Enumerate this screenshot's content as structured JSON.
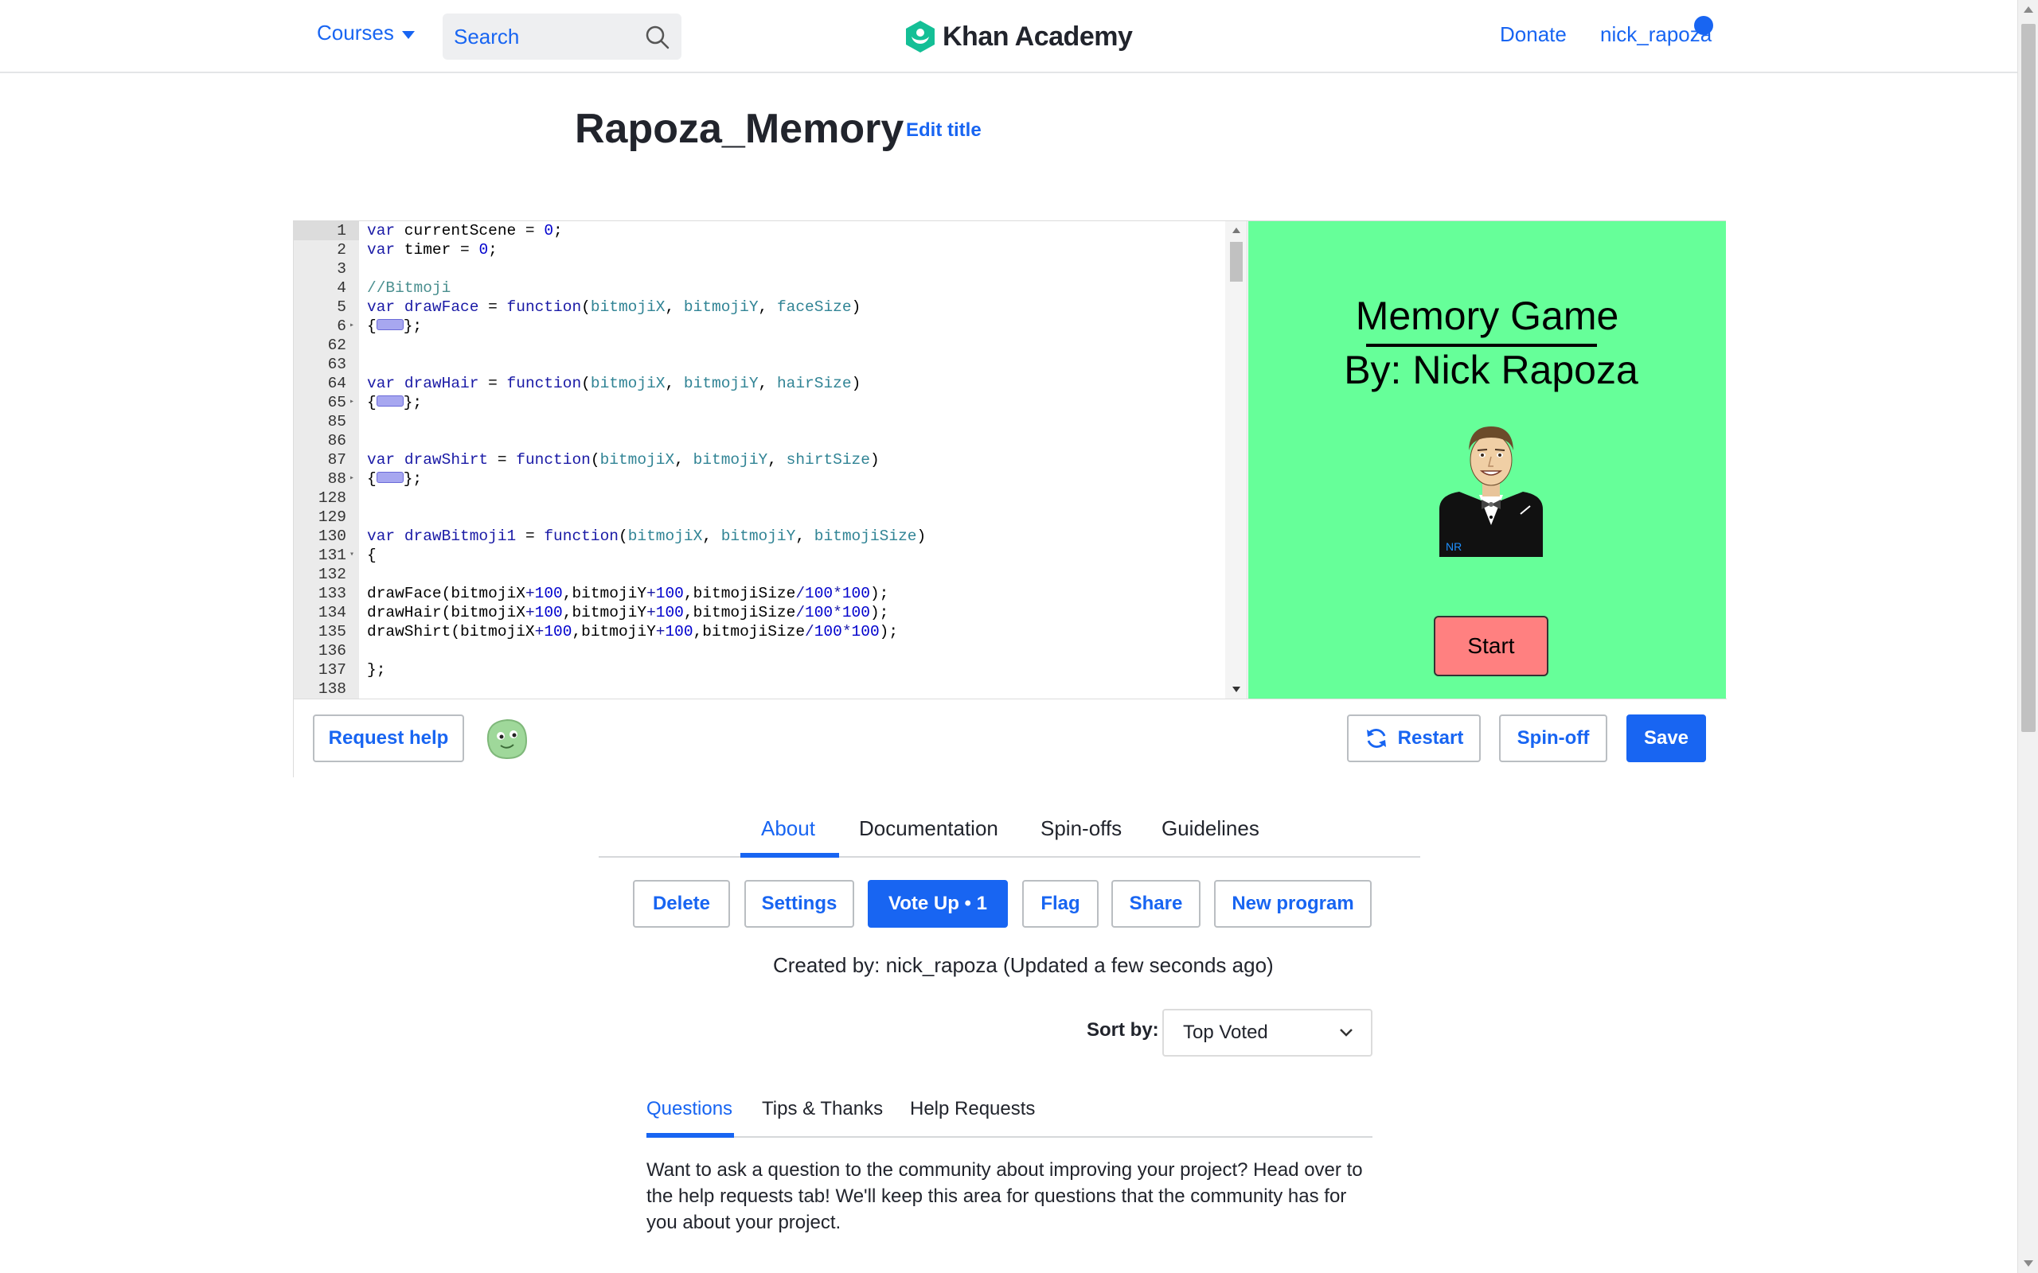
{
  "header": {
    "courses_label": "Courses",
    "search_placeholder": "Search",
    "brand": "Khan Academy",
    "donate_label": "Donate",
    "username": "nick_rapoza"
  },
  "project": {
    "title": "Rapoza_Memory",
    "edit_title_label": "Edit title"
  },
  "editor": {
    "lines": [
      {
        "n": "1",
        "fold": "",
        "html": "<span class=\"kw\">var</span> currentScene = <span class=\"num\">0</span>;",
        "active": true
      },
      {
        "n": "2",
        "fold": "",
        "html": "<span class=\"kw\">var</span> timer = <span class=\"num\">0</span>;"
      },
      {
        "n": "3",
        "fold": "",
        "html": ""
      },
      {
        "n": "4",
        "fold": "",
        "html": "<span class=\"cm\">//Bitmoji</span>"
      },
      {
        "n": "5",
        "fold": "",
        "html": "<span class=\"kw\">var</span> <span class=\"kw\">drawFace</span> = <span class=\"kw\">function</span>(<span class=\"prm\">bitmojiX</span>, <span class=\"prm\">bitmojiY</span>, <span class=\"prm\">faceSize</span>)"
      },
      {
        "n": "6",
        "fold": "▸",
        "html": "{<span class=\"fold-widget\"></span>};"
      },
      {
        "n": "62",
        "fold": "",
        "html": ""
      },
      {
        "n": "63",
        "fold": "",
        "html": ""
      },
      {
        "n": "64",
        "fold": "",
        "html": "<span class=\"kw\">var</span> <span class=\"kw\">drawHair</span> = <span class=\"kw\">function</span>(<span class=\"prm\">bitmojiX</span>, <span class=\"prm\">bitmojiY</span>, <span class=\"prm\">hairSize</span>)"
      },
      {
        "n": "65",
        "fold": "▸",
        "html": "{<span class=\"fold-widget\"></span>};"
      },
      {
        "n": "85",
        "fold": "",
        "html": ""
      },
      {
        "n": "86",
        "fold": "",
        "html": ""
      },
      {
        "n": "87",
        "fold": "",
        "html": "<span class=\"kw\">var</span> <span class=\"kw\">drawShirt</span> = <span class=\"kw\">function</span>(<span class=\"prm\">bitmojiX</span>, <span class=\"prm\">bitmojiY</span>, <span class=\"prm\">shirtSize</span>)"
      },
      {
        "n": "88",
        "fold": "▸",
        "html": "{<span class=\"fold-widget\"></span>};"
      },
      {
        "n": "128",
        "fold": "",
        "html": ""
      },
      {
        "n": "129",
        "fold": "",
        "html": ""
      },
      {
        "n": "130",
        "fold": "",
        "html": "<span class=\"kw\">var</span> <span class=\"kw\">drawBitmoji1</span> = <span class=\"kw\">function</span>(<span class=\"prm\">bitmojiX</span>, <span class=\"prm\">bitmojiY</span>, <span class=\"prm\">bitmojiSize</span>)"
      },
      {
        "n": "131",
        "fold": "▾",
        "html": "{"
      },
      {
        "n": "132",
        "fold": "",
        "html": ""
      },
      {
        "n": "133",
        "fold": "",
        "html": "drawFace(bitmojiX<span class=\"kw\">+</span><span class=\"num\">100</span>,bitmojiY<span class=\"kw\">+</span><span class=\"num\">100</span>,bitmojiSize<span class=\"kw\">/</span><span class=\"num\">100</span><span class=\"kw\">*</span><span class=\"num\">100</span>);"
      },
      {
        "n": "134",
        "fold": "",
        "html": "drawHair(bitmojiX<span class=\"kw\">+</span><span class=\"num\">100</span>,bitmojiY<span class=\"kw\">+</span><span class=\"num\">100</span>,bitmojiSize<span class=\"kw\">/</span><span class=\"num\">100</span><span class=\"kw\">*</span><span class=\"num\">100</span>);"
      },
      {
        "n": "135",
        "fold": "",
        "html": "drawShirt(bitmojiX<span class=\"kw\">+</span><span class=\"num\">100</span>,bitmojiY<span class=\"kw\">+</span><span class=\"num\">100</span>,bitmojiSize<span class=\"kw\">/</span><span class=\"num\">100</span><span class=\"kw\">*</span><span class=\"num\">100</span>);"
      },
      {
        "n": "136",
        "fold": "",
        "html": ""
      },
      {
        "n": "137",
        "fold": "",
        "html": "};"
      },
      {
        "n": "138",
        "fold": "",
        "html": ""
      }
    ]
  },
  "canvas": {
    "title": "Memory Game",
    "subtitle": "By: Nick Rapoza",
    "badge": "NR",
    "start_label": "Start",
    "background": "#66ff99"
  },
  "toolbar": {
    "request_help_label": "Request help",
    "restart_label": "Restart",
    "spinoff_label": "Spin-off",
    "save_label": "Save"
  },
  "tabs": [
    "About",
    "Documentation",
    "Spin-offs",
    "Guidelines"
  ],
  "actions": {
    "delete_label": "Delete",
    "settings_label": "Settings",
    "voteup_label": "Vote Up • 1",
    "flag_label": "Flag",
    "share_label": "Share",
    "newprogram_label": "New program"
  },
  "meta": {
    "created_text": "Created by: nick_rapoza (Updated a few seconds ago)",
    "sort_label": "Sort by:",
    "sort_value": "Top Voted"
  },
  "subtabs": [
    "Questions",
    "Tips & Thanks",
    "Help Requests"
  ],
  "questions_text": "Want to ask a question to the community about improving your project? Head over to the help requests tab! We'll keep this area for questions that the community has for you about your project.",
  "colors": {
    "accent": "#1865f2",
    "start_button": "#ff8080"
  }
}
